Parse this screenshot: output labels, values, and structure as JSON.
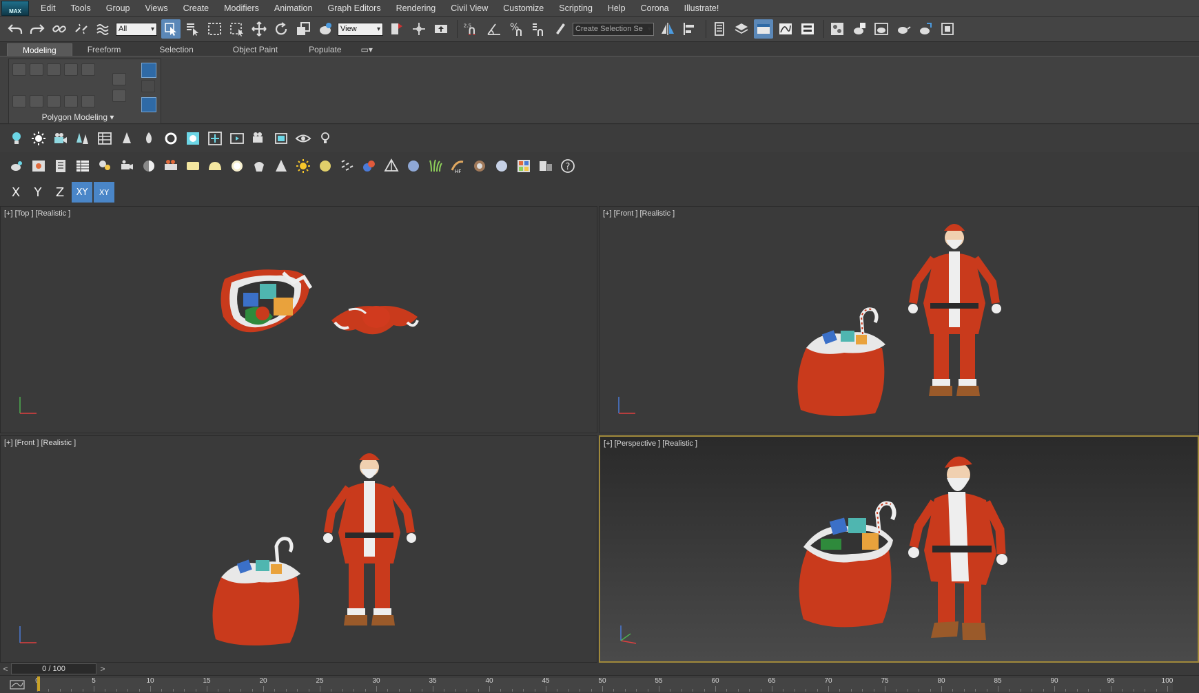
{
  "app": {
    "logo_text": "MAX"
  },
  "menu": [
    "Edit",
    "Tools",
    "Group",
    "Views",
    "Create",
    "Modifiers",
    "Animation",
    "Graph Editors",
    "Rendering",
    "Civil View",
    "Customize",
    "Scripting",
    "Help",
    "Corona",
    "Illustrate!"
  ],
  "toolbar": {
    "selection_filter": "All",
    "reference_coord": "View",
    "snap_value": "2.5",
    "named_selection_placeholder": "Create Selection Se"
  },
  "ribbon": {
    "tabs": [
      "Modeling",
      "Freeform",
      "Selection",
      "Object Paint",
      "Populate"
    ],
    "active_tab": "Modeling",
    "panel_label": "Polygon Modeling ▾"
  },
  "axis_constraints": [
    "X",
    "Y",
    "Z",
    "XY",
    "XY"
  ],
  "viewports": [
    {
      "label": "[+] [Top ] [Realistic ]",
      "view": "top"
    },
    {
      "label": "[+] [Front ] [Realistic ]",
      "view": "front"
    },
    {
      "label": "[+] [Front ] [Realistic ]",
      "view": "front"
    },
    {
      "label": "[+] [Perspective ] [Realistic ]",
      "view": "perspective",
      "active": true
    }
  ],
  "timeline": {
    "frame_display": "0 / 100",
    "prev_arrow": "<",
    "next_arrow": ">",
    "ticks": [
      "0",
      "5",
      "10",
      "15",
      "20",
      "25",
      "30",
      "35",
      "40",
      "45",
      "50",
      "55",
      "60",
      "65",
      "70",
      "75",
      "80",
      "85",
      "90",
      "95",
      "100"
    ]
  },
  "colors": {
    "santa_red": "#d0341a",
    "sack_red": "#c93a1c",
    "fur_white": "#e8e8e8",
    "active_viewport_border": "#a18a3b",
    "active_button": "#4a86c8"
  }
}
